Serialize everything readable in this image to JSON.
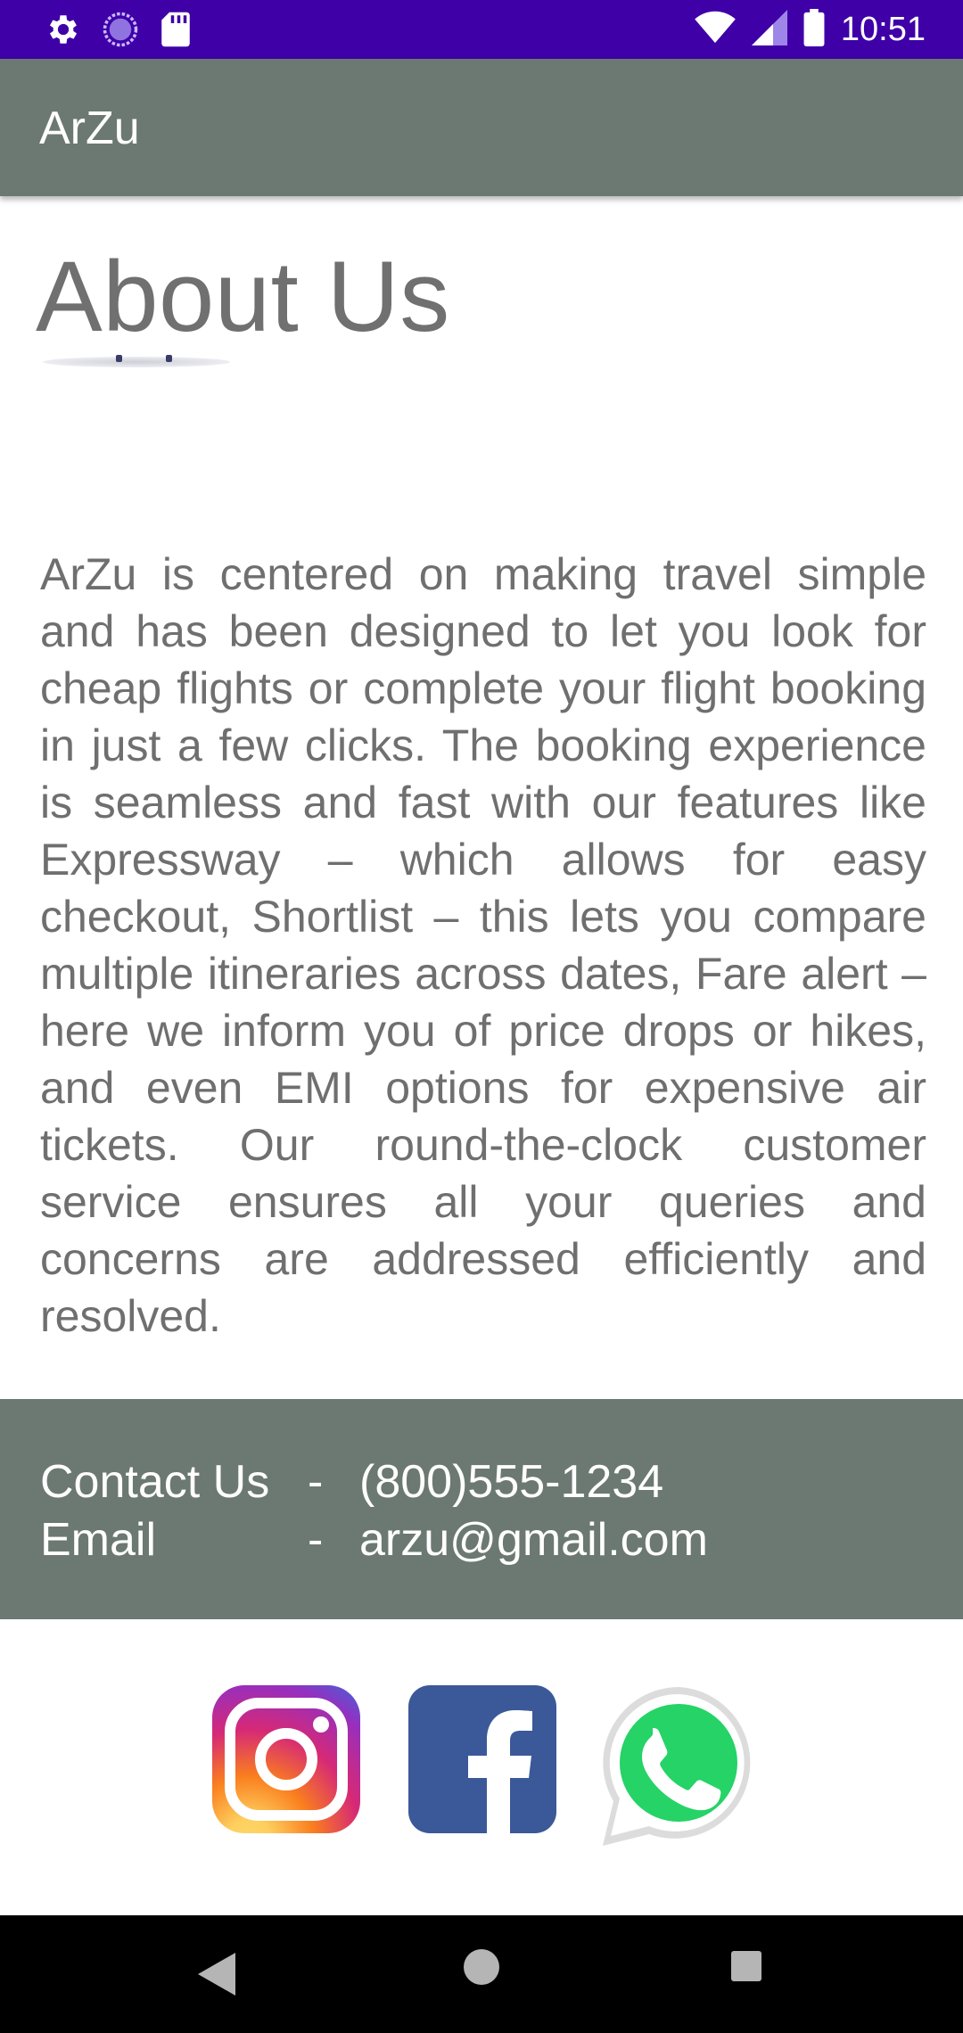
{
  "status_bar": {
    "time": "10:51",
    "icons": [
      "settings-icon",
      "sync-icon",
      "sd-card-icon",
      "wifi-icon",
      "signal-icon",
      "battery-icon"
    ]
  },
  "app_bar": {
    "title": "ArZu"
  },
  "about": {
    "heading": "About Us",
    "body": "ArZu is centered on making travel simple and has been designed to let you look for cheap flights or complete your flight booking in just a few clicks. The booking experience is seamless and fast with our features like Expressway – which allows for easy checkout, Shortlist – this lets you compare multiple itineraries across dates, Fare alert – here we inform you of price drops or hikes, and even EMI options for expensive air tickets. Our round-the-clock customer service ensures all your queries and concerns are addressed efficiently and resolved."
  },
  "contact": {
    "phone_label": "Contact Us",
    "phone_separator": "-",
    "phone_value": "(800)555-1234",
    "email_label": "Email",
    "email_separator": "-",
    "email_value": "arzu@gmail.com"
  },
  "social": {
    "icons": [
      "instagram-icon",
      "facebook-icon",
      "whatsapp-icon"
    ]
  },
  "nav_bar": {
    "icons": [
      "back-icon",
      "home-icon",
      "recents-icon"
    ]
  },
  "colors": {
    "status_bar": "#3f00a8",
    "app_bar": "#6c7972",
    "contact_panel": "#6c7972",
    "body_text": "#6f6f6f",
    "facebook": "#3b5998",
    "whatsapp": "#25d366"
  }
}
